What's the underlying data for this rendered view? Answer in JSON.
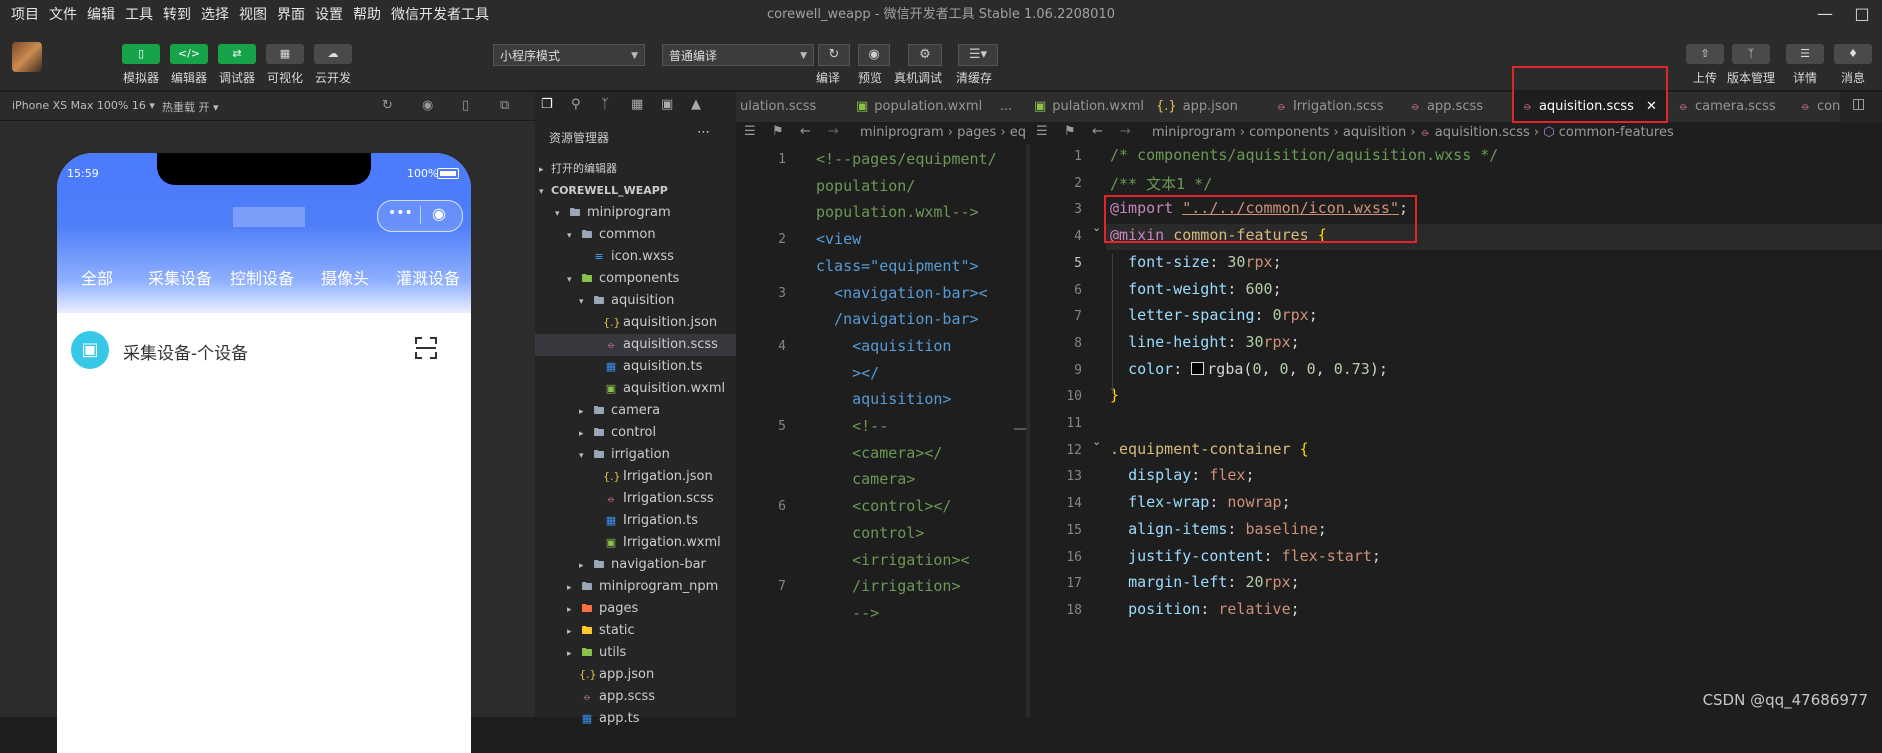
{
  "app": {
    "menu": [
      "项目",
      "文件",
      "编辑",
      "工具",
      "转到",
      "选择",
      "视图",
      "界面",
      "设置",
      "帮助",
      "微信开发者工具"
    ],
    "window_title": "corewell_weapp - 微信开发者工具 Stable 1.06.2208010"
  },
  "toolbar": {
    "left_buttons": [
      {
        "label": "模拟器",
        "icon": "phone-icon",
        "style": "green"
      },
      {
        "label": "编辑器",
        "icon": "code-icon",
        "style": "green"
      },
      {
        "label": "调试器",
        "icon": "debug-icon",
        "style": "green"
      },
      {
        "label": "可视化",
        "icon": "layout-icon",
        "style": "gray"
      },
      {
        "label": "云开发",
        "icon": "cloud-icon",
        "style": "gray"
      }
    ],
    "mode_select": "小程序模式",
    "compile_select": "普通编译",
    "center_buttons": [
      "编译",
      "预览",
      "真机调试",
      "清缓存"
    ],
    "right_buttons": [
      "上传",
      "版本管理",
      "详情",
      "消息"
    ]
  },
  "simulator": {
    "device": "iPhone XS Max 100% 16",
    "hot_reload": "热重载 开",
    "status_time": "15:59",
    "battery": "100%",
    "tabs": [
      "全部",
      "采集设备",
      "控制设备",
      "摄像头",
      "灌溉设备"
    ],
    "device_row_label": "采集设备-个设备"
  },
  "explorer": {
    "title": "资源管理器",
    "open_editors": "打开的编辑器",
    "project": "COREWELL_WEAPP",
    "tree": [
      {
        "label": "miniprogram",
        "depth": 1,
        "type": "folder",
        "open": true
      },
      {
        "label": "common",
        "depth": 2,
        "type": "folder",
        "open": true
      },
      {
        "label": "icon.wxss",
        "depth": 3,
        "type": "wxss"
      },
      {
        "label": "components",
        "depth": 2,
        "type": "folder-green",
        "open": true
      },
      {
        "label": "aquisition",
        "depth": 3,
        "type": "folder",
        "open": true
      },
      {
        "label": "aquisition.json",
        "depth": 4,
        "type": "json"
      },
      {
        "label": "aquisition.scss",
        "depth": 4,
        "type": "scss",
        "selected": true
      },
      {
        "label": "aquisition.ts",
        "depth": 4,
        "type": "ts"
      },
      {
        "label": "aquisition.wxml",
        "depth": 4,
        "type": "wxml"
      },
      {
        "label": "camera",
        "depth": 3,
        "type": "folder",
        "open": false
      },
      {
        "label": "control",
        "depth": 3,
        "type": "folder",
        "open": false
      },
      {
        "label": "irrigation",
        "depth": 3,
        "type": "folder",
        "open": true
      },
      {
        "label": "Irrigation.json",
        "depth": 4,
        "type": "json"
      },
      {
        "label": "Irrigation.scss",
        "depth": 4,
        "type": "scss"
      },
      {
        "label": "Irrigation.ts",
        "depth": 4,
        "type": "ts"
      },
      {
        "label": "Irrigation.wxml",
        "depth": 4,
        "type": "wxml"
      },
      {
        "label": "navigation-bar",
        "depth": 3,
        "type": "folder",
        "open": false
      },
      {
        "label": "miniprogram_npm",
        "depth": 2,
        "type": "folder",
        "open": false
      },
      {
        "label": "pages",
        "depth": 2,
        "type": "folder-orange",
        "open": false
      },
      {
        "label": "static",
        "depth": 2,
        "type": "folder-yellow",
        "open": false
      },
      {
        "label": "utils",
        "depth": 2,
        "type": "folder-green",
        "open": false
      },
      {
        "label": "app.json",
        "depth": 2,
        "type": "json"
      },
      {
        "label": "app.scss",
        "depth": 2,
        "type": "scss"
      },
      {
        "label": "app.ts",
        "depth": 2,
        "type": "ts"
      }
    ]
  },
  "tabs": [
    {
      "label": "ulation.scss",
      "type": "scss"
    },
    {
      "label": "population.wxml",
      "type": "wxml"
    },
    {
      "label": "...",
      "type": "more"
    },
    {
      "label": "pulation.wxml",
      "type": "wxml"
    },
    {
      "label": "app.json",
      "type": "json"
    },
    {
      "label": "Irrigation.scss",
      "type": "scss"
    },
    {
      "label": "app.scss",
      "type": "scss"
    },
    {
      "label": "aquisition.scss",
      "type": "scss",
      "active": true
    },
    {
      "label": "camera.scss",
      "type": "scss"
    },
    {
      "label": "con",
      "type": "scss"
    }
  ],
  "left_breadcrumb": "miniprogram › pages › equi",
  "right_breadcrumb": {
    "path": "miniprogram › components › aquisition ›",
    "file": "aquisition.scss",
    "symbol": "common-features"
  },
  "left_code": {
    "line_numbers": [
      "1",
      "",
      "",
      "2",
      "",
      "3",
      "",
      "4",
      "",
      "",
      "5",
      "",
      "",
      "6",
      "",
      "",
      "7",
      ""
    ],
    "lines": [
      "<!--pages/equipment/",
      "population/",
      "population.wxml-->",
      "<view",
      "class=\"equipment\">",
      "  <navigation-bar><",
      "  /navigation-bar>",
      "    <aquisition",
      "    ></",
      "    aquisition>",
      "    <!--",
      "    <camera></",
      "    camera>",
      "    <control></",
      "    control>",
      "    <irrigation><",
      "    /irrigation>",
      "    -->"
    ]
  },
  "right_code": {
    "lines": [
      {
        "n": "1",
        "text": "/* components/aquisition/aquisition.wxss */"
      },
      {
        "n": "2",
        "text": "/** 文本1 */"
      },
      {
        "n": "3",
        "text": "@import \"../../common/icon.wxss\";"
      },
      {
        "n": "4",
        "text": "@mixin common-features {"
      },
      {
        "n": "5",
        "text": "  font-size: 30rpx;"
      },
      {
        "n": "6",
        "text": "  font-weight: 600;"
      },
      {
        "n": "7",
        "text": "  letter-spacing: 0rpx;"
      },
      {
        "n": "8",
        "text": "  line-height: 30rpx;"
      },
      {
        "n": "9",
        "text": "  color: rgba(0, 0, 0, 0.73);"
      },
      {
        "n": "10",
        "text": "}"
      },
      {
        "n": "11",
        "text": ""
      },
      {
        "n": "12",
        "text": ".equipment-container {"
      },
      {
        "n": "13",
        "text": "  display: flex;"
      },
      {
        "n": "14",
        "text": "  flex-wrap: nowrap;"
      },
      {
        "n": "15",
        "text": "  align-items: baseline;"
      },
      {
        "n": "16",
        "text": "  justify-content: flex-start;"
      },
      {
        "n": "17",
        "text": "  margin-left: 20rpx;"
      },
      {
        "n": "18",
        "text": "  position: relative;"
      }
    ]
  },
  "watermark": "CSDN @qq_47686977",
  "colors": {
    "accent_red": "#e0262a",
    "green": "#16a34a",
    "blue": "#4a7bff",
    "scss_pink": "#d46fa3"
  }
}
